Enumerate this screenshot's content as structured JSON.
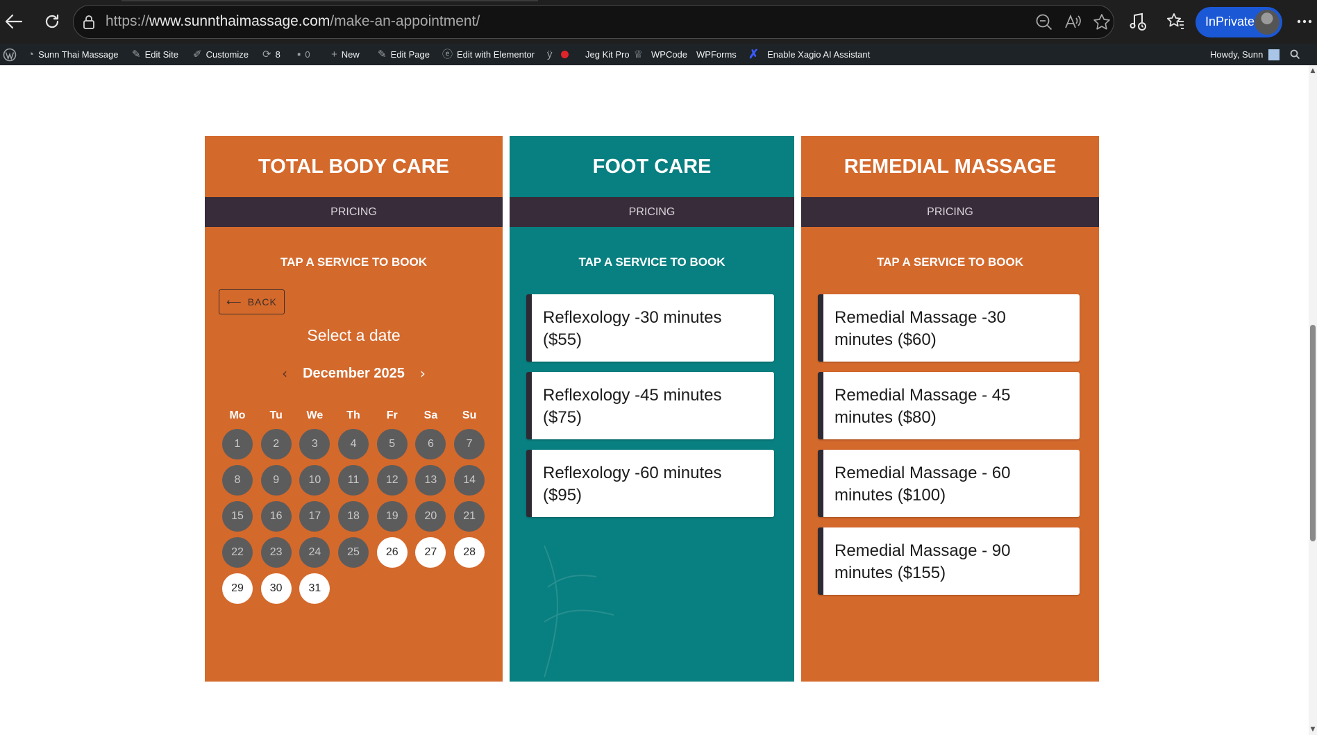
{
  "browser": {
    "url_scheme": "https://",
    "url_host": "www.sunnthaimassage.com",
    "url_path": "/make-an-appointment/",
    "inprivate_label": "InPrivate"
  },
  "admin_bar": {
    "site_name": "Sunn Thai Massage",
    "edit_site": "Edit Site",
    "customize": "Customize",
    "updates_count": "8",
    "comments_count": "0",
    "new": "New",
    "edit_page": "Edit Page",
    "edit_elementor": "Edit with Elementor",
    "jeg_kit": "Jeg Kit Pro",
    "wpcode": "WPCode",
    "wpforms": "WPForms",
    "xagio": "Enable Xagio AI Assistant",
    "howdy": "Howdy, Sunn"
  },
  "cards": [
    {
      "title": "TOTAL BODY CARE",
      "pricing_label": "PRICING",
      "tap_label": "TAP A SERVICE TO BOOK",
      "color": "#d4692c"
    },
    {
      "title": "FOOT CARE",
      "pricing_label": "PRICING",
      "tap_label": "TAP A SERVICE TO BOOK",
      "color": "#087f80",
      "services": [
        "Reflexology -30 minutes ($55)",
        "Reflexology -45 minutes ($75)",
        "Reflexology -60 minutes ($95)"
      ]
    },
    {
      "title": "REMEDIAL MASSAGE",
      "pricing_label": "PRICING",
      "tap_label": "TAP A SERVICE TO BOOK",
      "color": "#d4692c",
      "services": [
        "Remedial Massage -30 minutes ($60)",
        "Remedial Massage - 45 minutes ($80)",
        "Remedial Massage - 60 minutes ($100)",
        "Remedial Massage - 90 minutes ($155)"
      ]
    }
  ],
  "calendar": {
    "back_label": "BACK",
    "heading": "Select a date",
    "month": "December 2025",
    "weekdays": [
      "Mo",
      "Tu",
      "We",
      "Th",
      "Fr",
      "Sa",
      "Su"
    ],
    "days_past": [
      "1",
      "2",
      "3",
      "4",
      "5",
      "6",
      "7",
      "8",
      "9",
      "10",
      "11",
      "12",
      "13",
      "14",
      "15",
      "16",
      "17",
      "18",
      "19",
      "20",
      "21",
      "22",
      "23",
      "24",
      "25"
    ],
    "days_available": [
      "26",
      "27",
      "28",
      "29",
      "30",
      "31"
    ]
  }
}
